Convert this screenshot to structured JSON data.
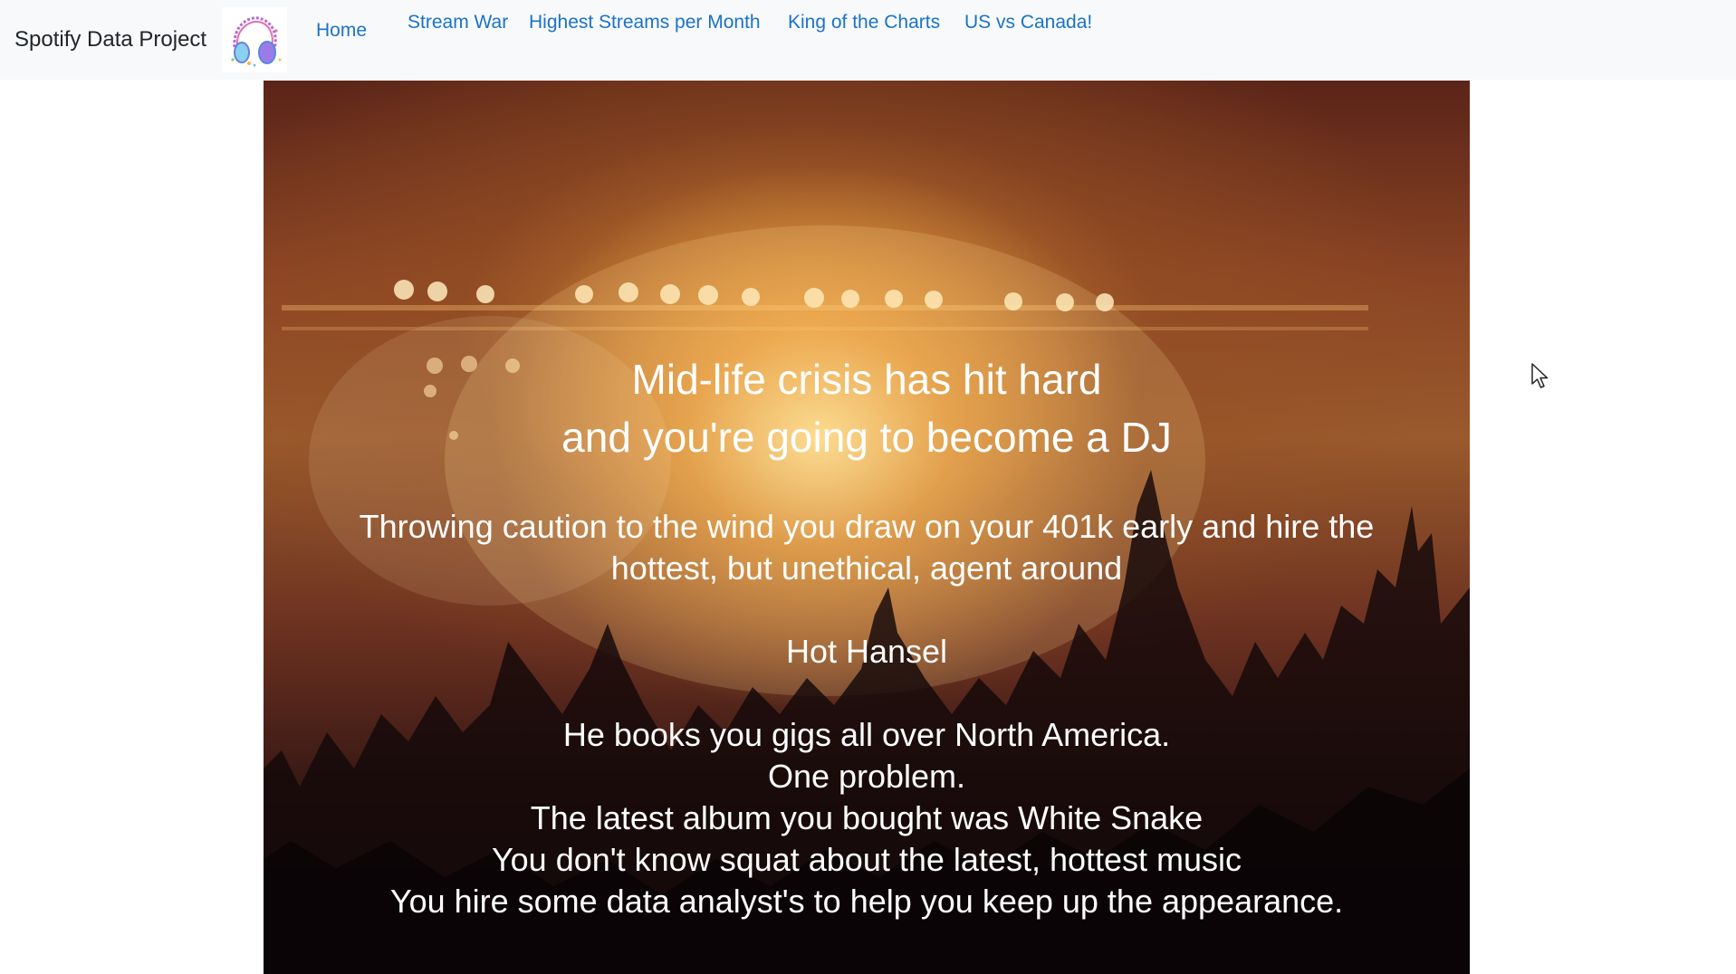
{
  "navbar": {
    "brand": "Spotify Data Project",
    "logo_icon": "headphones-logo-icon",
    "links": [
      {
        "label": "Home"
      },
      {
        "label": "Stream War"
      },
      {
        "label": "Highest Streams per Month"
      },
      {
        "label": "King of the Charts"
      },
      {
        "label": "US vs Canada!"
      }
    ],
    "link_color": "#1a73c9"
  },
  "hero": {
    "heading_line1": "Mid-life crisis has hit hard",
    "heading_line2": "and you're going to become a DJ",
    "paragraph_line1": "Throwing caution to the wind you draw on your 401k early and hire the",
    "paragraph_line2": "hottest, but unethical, agent around",
    "agent_name": "Hot Hansel",
    "story": [
      "He books you gigs all over North America.",
      "One problem.",
      "The latest album you bought was White Snake",
      "You don't know squat about the latest, hottest music",
      "You hire some data analyst's to help you keep up the appearance."
    ]
  }
}
